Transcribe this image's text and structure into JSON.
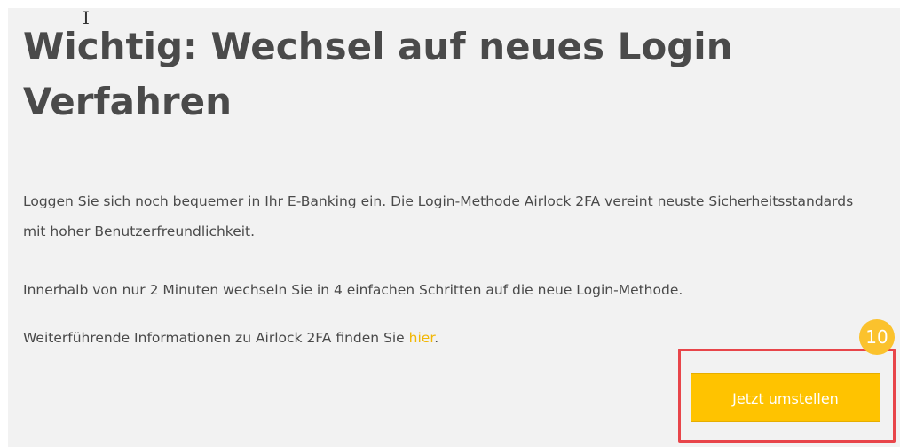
{
  "cursor_icon": "text-cursor-icon",
  "title": "Wichtig: Wechsel auf neues Login Verfahren",
  "paragraphs": {
    "intro": "Loggen Sie sich noch bequemer in Ihr E-Banking ein. Die Login-Methode Airlock 2FA vereint neuste Sicherheitsstandards mit hoher Benutzerfreundlichkeit.",
    "steps": "Innerhalb von nur 2 Minuten wechseln Sie in 4 einfachen Schritten auf die neue Login-Methode.",
    "info_prefix": "Weiterführende Informationen zu Airlock 2FA finden Sie ",
    "info_link": "hier",
    "info_suffix": "."
  },
  "annotation": {
    "badge_number": "10",
    "highlight_color": "#e8454a",
    "badge_color": "#fbc22d"
  },
  "cta": {
    "label": "Jetzt umstellen",
    "color": "#ffc300"
  },
  "colors": {
    "panel_background": "#f2f2f2",
    "text": "#4a4a4a",
    "link": "#f2b705"
  }
}
